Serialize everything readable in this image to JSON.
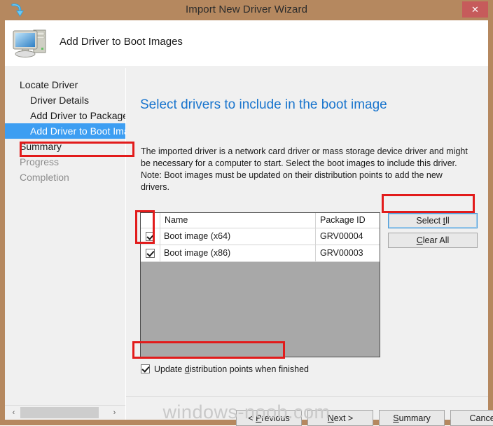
{
  "window": {
    "title": "Import New Driver Wizard",
    "close_label": "✕",
    "import_icon": "import-arrow-icon"
  },
  "header": {
    "title": "Add Driver to Boot Images",
    "icon": "computer-icon"
  },
  "sidebar": {
    "items": [
      {
        "label": "Locate Driver",
        "indent": false,
        "state": "normal"
      },
      {
        "label": "Driver Details",
        "indent": true,
        "state": "normal"
      },
      {
        "label": "Add Driver to Packages",
        "indent": true,
        "state": "normal"
      },
      {
        "label": "Add Driver to Boot Images",
        "indent": true,
        "state": "selected"
      },
      {
        "label": "Summary",
        "indent": false,
        "state": "normal"
      },
      {
        "label": "Progress",
        "indent": false,
        "state": "dim"
      },
      {
        "label": "Completion",
        "indent": false,
        "state": "dim"
      }
    ],
    "scrollbar": {
      "left_arrow": "‹",
      "right_arrow": "›"
    }
  },
  "main": {
    "heading": "Select drivers to include in the boot image",
    "body_text": "The imported driver is a network card driver or mass storage device driver and might be necessary for a computer to start. Select the boot images to include this driver.  Note: Boot images must be updated on their distribution points to add the new drivers.",
    "table": {
      "columns": [
        "",
        "Name",
        "Package ID"
      ],
      "rows": [
        {
          "checked": true,
          "name": "Boot image (x64)",
          "package_id": "GRV00004"
        },
        {
          "checked": true,
          "name": "Boot image (x86)",
          "package_id": "GRV00003"
        }
      ]
    },
    "select_all_label": "Select All",
    "select_all_accel": "t",
    "clear_all_label": "Clear All",
    "clear_all_accel": "C",
    "update_checkbox": {
      "checked": true,
      "label_before": "Update ",
      "label_accel": "d",
      "label_after": "istribution points when finished"
    }
  },
  "footer": {
    "buttons": [
      {
        "prefix": "< ",
        "accel": "P",
        "suffix": "revious"
      },
      {
        "prefix": "",
        "accel": "N",
        "suffix": "ext >"
      },
      {
        "prefix": "",
        "accel": "S",
        "suffix": "ummary"
      },
      {
        "prefix": "",
        "accel": "",
        "suffix": "Cancel"
      }
    ]
  },
  "watermark": "windows-noob.com",
  "colors": {
    "titlebar": "#b5885f",
    "close": "#c65b5b",
    "heading": "#1874cd",
    "selection": "#3d9ef2",
    "annotation": "#e21b1b",
    "list_empty": "#a8a8a8"
  }
}
